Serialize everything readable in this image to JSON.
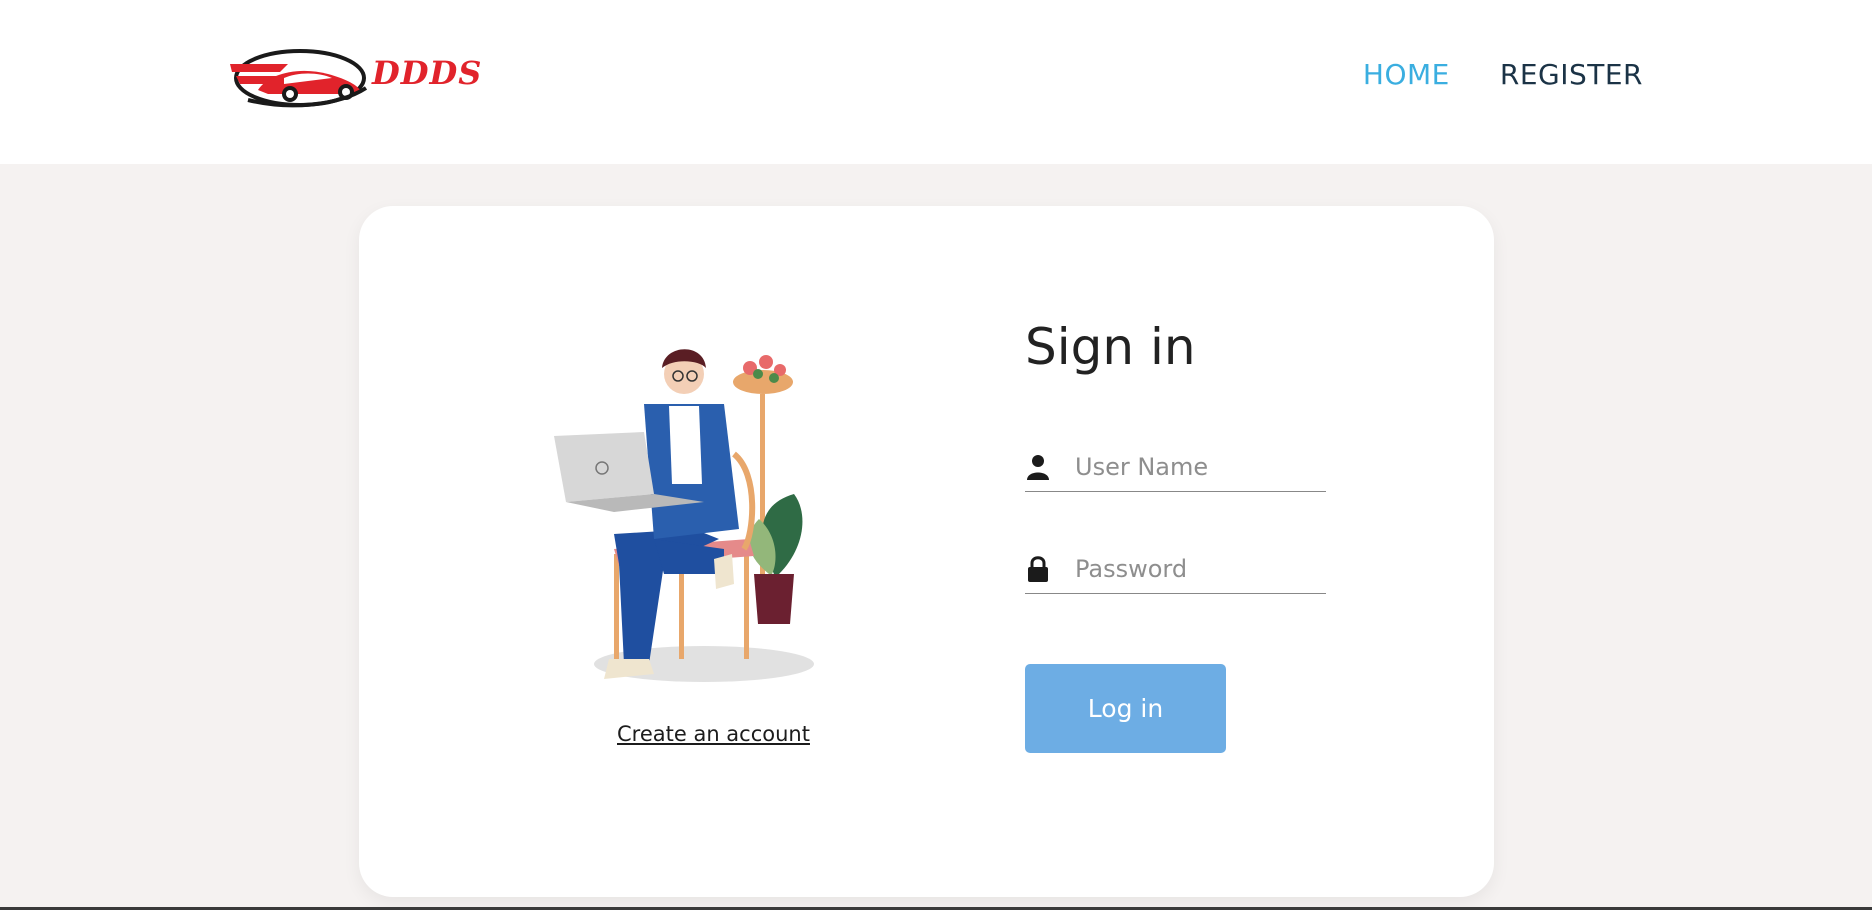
{
  "header": {
    "logo_text": "DDDS",
    "nav": {
      "home_label": "HOME",
      "register_label": "REGISTER"
    }
  },
  "colors": {
    "accent": "#3aaee0",
    "nav_dark": "#1b3346",
    "button": "#6dade4",
    "logo_red": "#e1232b",
    "page_bg": "#f5f2f1"
  },
  "login": {
    "title": "Sign in",
    "username_placeholder": "User Name",
    "password_placeholder": "Password",
    "login_button": "Log in",
    "create_account_link": "Create an account"
  },
  "icons": {
    "user": "user-icon",
    "lock": "lock-icon",
    "logo": "car-logo-icon"
  }
}
